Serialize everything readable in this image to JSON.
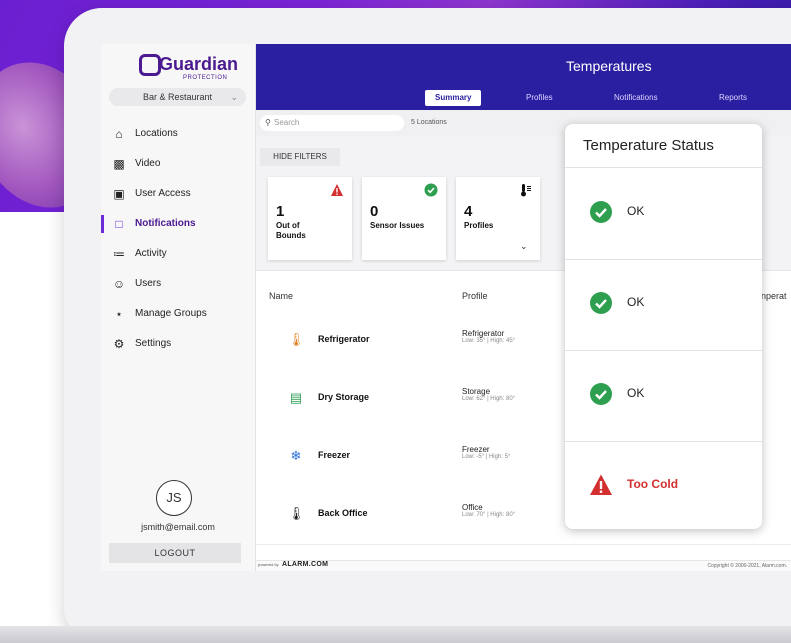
{
  "sidebar": {
    "logo_text": "Guardian",
    "logo_sub": "PROTECTION",
    "account": "Bar & Restaurant",
    "items": [
      {
        "label": "Locations",
        "icon": "house-icon"
      },
      {
        "label": "Video",
        "icon": "video-camera-icon"
      },
      {
        "label": "User Access",
        "icon": "badge-icon"
      },
      {
        "label": "Notifications",
        "icon": "notification-icon"
      },
      {
        "label": "Activity",
        "icon": "activity-icon"
      },
      {
        "label": "Users",
        "icon": "users-icon"
      },
      {
        "label": "Manage Groups",
        "icon": "groups-icon"
      },
      {
        "label": "Settings",
        "icon": "gear-icon"
      }
    ],
    "active_item": "Notifications",
    "user_initials": "JS",
    "user_email": "jsmith@email.com",
    "logout_label": "LOGOUT"
  },
  "header": {
    "title": "Temperatures",
    "tabs": [
      "Summary",
      "Profiles",
      "Notifications",
      "Reports"
    ],
    "active_tab": "Summary"
  },
  "toolbar": {
    "search_placeholder": "Search",
    "location_count": "5 Locations",
    "hide_filters_label": "HIDE FILTERS"
  },
  "stats": [
    {
      "value": "1",
      "label": "Out of Bounds",
      "icon": "warning-icon",
      "color": "#d32f2f"
    },
    {
      "value": "0",
      "label": "Sensor Issues",
      "icon": "check-circle-icon",
      "color": "#2e9e4f"
    },
    {
      "value": "4",
      "label": "Profiles",
      "icon": "thermometer-icon",
      "color": "#111111"
    }
  ],
  "table": {
    "columns": [
      "Name",
      "Profile",
      "nperat"
    ],
    "rows": [
      {
        "name": "Refrigerator",
        "profile": "Refrigerator",
        "range": "Low: 35° | High: 45°",
        "icon": "thermometer-icon",
        "icon_color": "#e07b1a"
      },
      {
        "name": "Dry Storage",
        "profile": "Storage",
        "range": "Low: 62° | High: 80°",
        "icon": "storage-icon",
        "icon_color": "#2e9e4f"
      },
      {
        "name": "Freezer",
        "profile": "Freezer",
        "range": "Low: -5° | High: 5°",
        "icon": "freezer-icon",
        "icon_color": "#2a6fd6"
      },
      {
        "name": "Back Office",
        "profile": "Office",
        "range": "Low: 70° | High: 80°",
        "icon": "thermometer-icon",
        "icon_color": "#111111"
      }
    ]
  },
  "footer": {
    "powered_by": "powered by",
    "brand": "ALARM.COM",
    "copyright": "Copyright © 2000-2021, Alarm.com."
  },
  "status_popup": {
    "title": "Temperature Status",
    "items": [
      {
        "text": "OK",
        "state": "ok"
      },
      {
        "text": "OK",
        "state": "ok"
      },
      {
        "text": "OK",
        "state": "ok"
      },
      {
        "text": "Too Cold",
        "state": "alert"
      }
    ],
    "ok_color": "#2e9e4f",
    "alert_color": "#d32f2f"
  },
  "colors": {
    "brand_purple": "#4b1a90",
    "header_blue": "#2b1fa1",
    "accent": "#6c2bd9"
  }
}
